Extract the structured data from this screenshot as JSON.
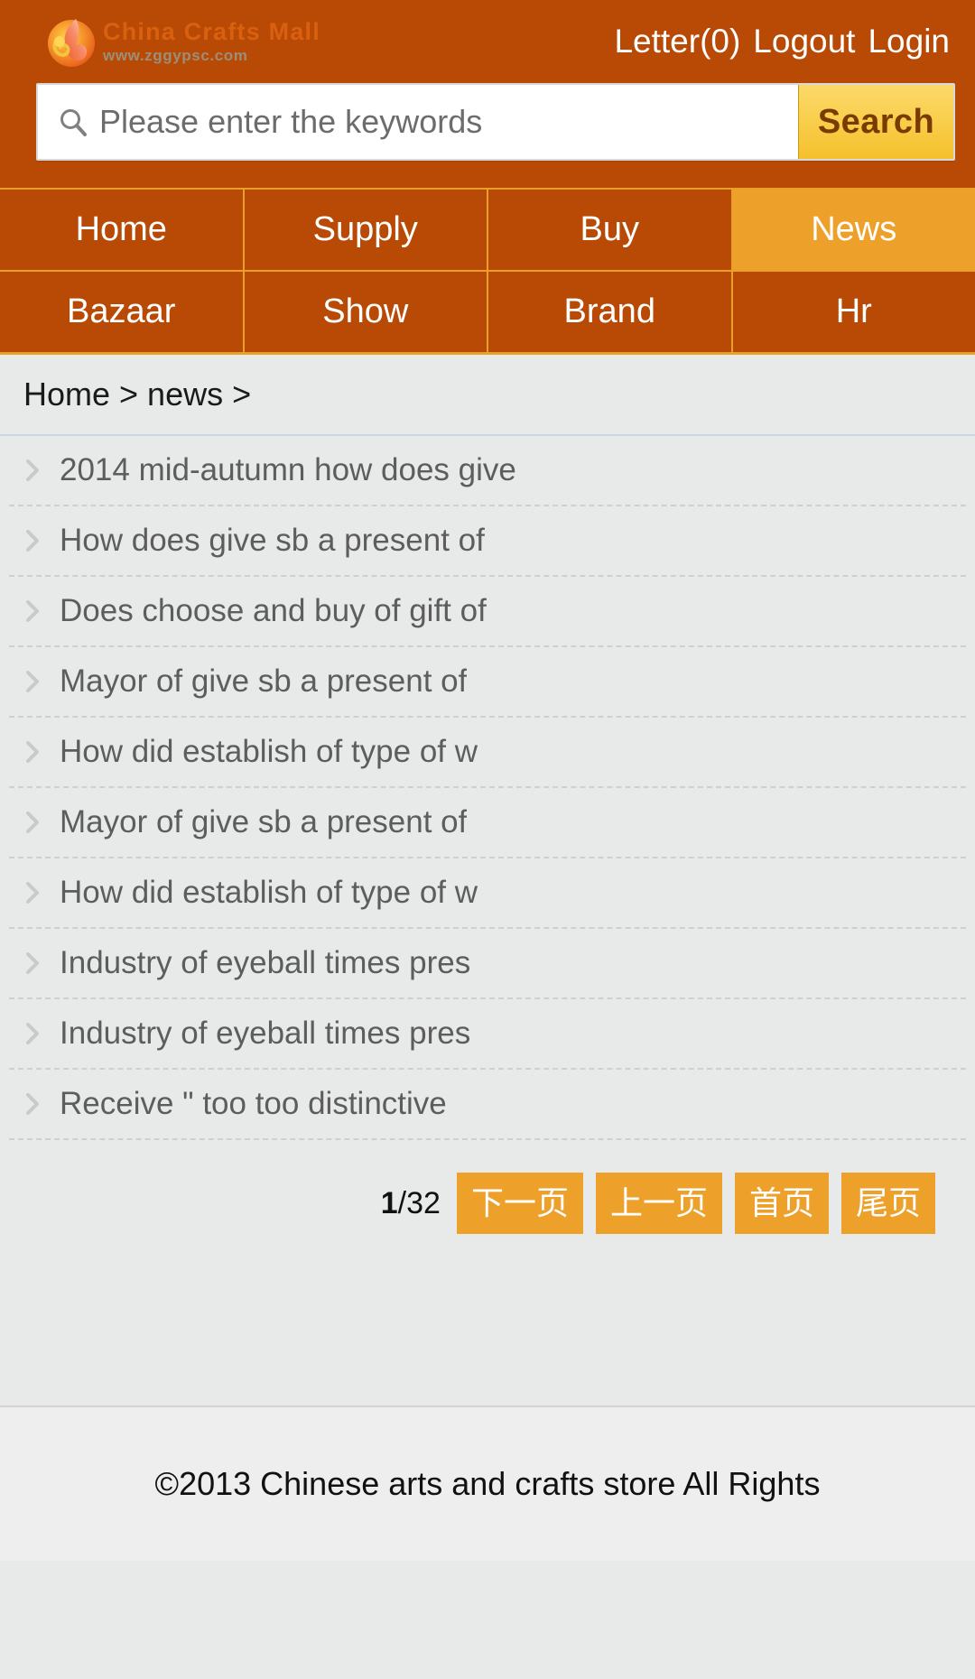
{
  "colors": {
    "header_bg": "#b84a05",
    "accent_orange": "#eda12b",
    "search_button_gold": "#f9cf4e",
    "page_bg": "#e8e9e9",
    "footer_bg": "#eeeeee"
  },
  "header": {
    "brand_name": "China Crafts Mall",
    "brand_url": "www.zggypsc.com",
    "logo_icon": "phoenix-flame-logo",
    "links": [
      {
        "label": "Letter(0)",
        "name": "letter-link"
      },
      {
        "label": "Logout",
        "name": "logout-link"
      },
      {
        "label": "Login",
        "name": "login-link"
      }
    ]
  },
  "search": {
    "icon": "search-icon",
    "value": "",
    "placeholder": "Please enter the keywords",
    "button_label": "Search"
  },
  "nav": {
    "items": [
      {
        "label": "Home",
        "active": false
      },
      {
        "label": "Supply",
        "active": false
      },
      {
        "label": "Buy",
        "active": false
      },
      {
        "label": "News",
        "active": true
      },
      {
        "label": "Bazaar",
        "active": false
      },
      {
        "label": "Show",
        "active": false
      },
      {
        "label": "Brand",
        "active": false
      },
      {
        "label": "Hr",
        "active": false
      }
    ]
  },
  "breadcrumb": {
    "text": "Home > news >"
  },
  "news": {
    "items": [
      {
        "title": "2014 mid-autumn how does give"
      },
      {
        "title": "How does give sb a present of"
      },
      {
        "title": "Does choose and buy of gift of"
      },
      {
        "title": "Mayor of give sb a present of"
      },
      {
        "title": "How did establish of type of w"
      },
      {
        "title": "Mayor of give sb a present of"
      },
      {
        "title": "How did establish of type of w"
      },
      {
        "title": "Industry of eyeball times pres"
      },
      {
        "title": "Industry of eyeball times pres"
      },
      {
        "title": "Receive \" too too distinctive"
      }
    ]
  },
  "pagination": {
    "current_page": "1",
    "separator": "/",
    "total_pages": "32",
    "buttons": [
      {
        "label": "下一页",
        "name": "next-page-button"
      },
      {
        "label": "上一页",
        "name": "prev-page-button"
      },
      {
        "label": "首页",
        "name": "first-page-button"
      },
      {
        "label": "尾页",
        "name": "last-page-button"
      }
    ]
  },
  "footer": {
    "copyright": "©2013 Chinese arts and crafts store All Rights"
  }
}
